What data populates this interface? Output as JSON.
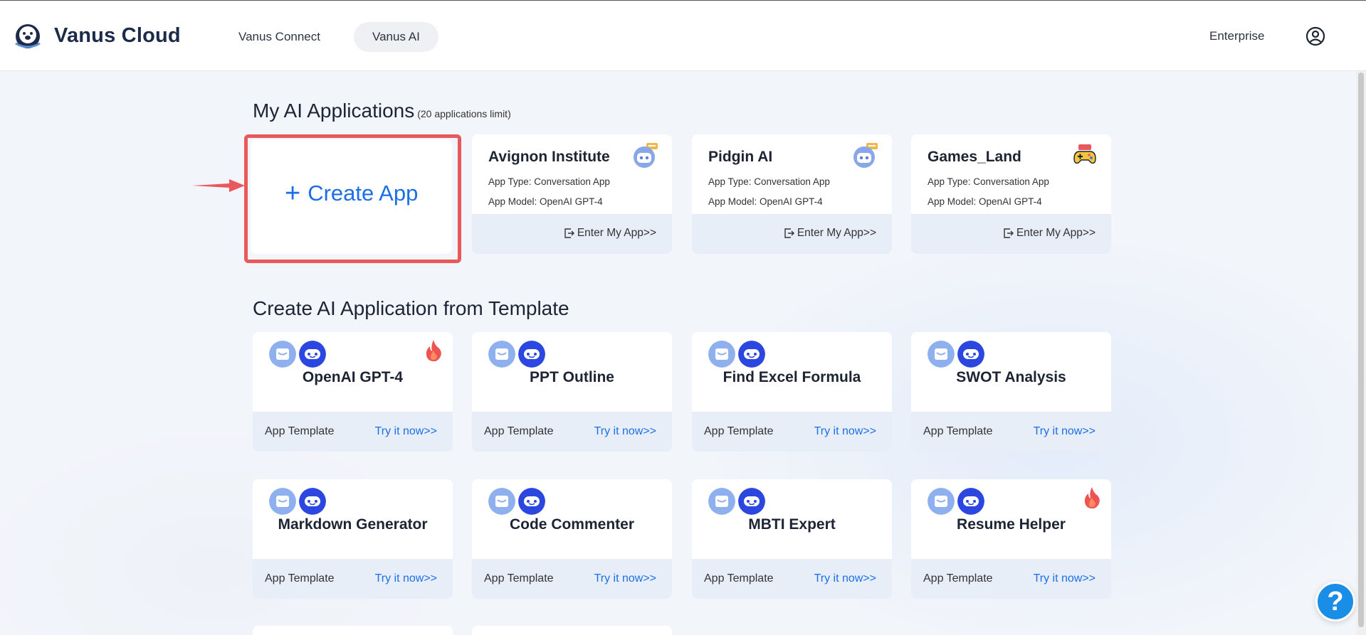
{
  "header": {
    "brand": "Vanus Cloud",
    "nav": [
      {
        "label": "Vanus Connect",
        "active": false
      },
      {
        "label": "Vanus AI",
        "active": true
      }
    ],
    "enterprise": "Enterprise"
  },
  "my_apps": {
    "title": "My AI Applications",
    "limit": "(20 applications limit)",
    "create_label": "Create App",
    "apps": [
      {
        "name": "Avignon Institute",
        "type": "App Type: Conversation App",
        "model": "App Model: OpenAI GPT-4",
        "enter": "Enter My App>>",
        "icon": "robot-chat-icon"
      },
      {
        "name": "Pidgin AI",
        "type": "App Type: Conversation App",
        "model": "App Model: OpenAI GPT-4",
        "enter": "Enter My App>>",
        "icon": "robot-chat-icon"
      },
      {
        "name": "Games_Land",
        "type": "App Type: Conversation App",
        "model": "App Model: OpenAI GPT-4",
        "enter": "Enter My App>>",
        "icon": "game-controller-icon"
      }
    ]
  },
  "templates": {
    "title": "Create AI Application from Template",
    "label": "App Template",
    "try": "Try it now>>",
    "items": [
      {
        "name": "OpenAI GPT-4",
        "hot": true
      },
      {
        "name": "PPT Outline",
        "hot": false
      },
      {
        "name": "Find Excel Formula",
        "hot": false
      },
      {
        "name": "SWOT Analysis",
        "hot": false
      },
      {
        "name": "Markdown Generator",
        "hot": false
      },
      {
        "name": "Code Commenter",
        "hot": false
      },
      {
        "name": "MBTI Expert",
        "hot": false
      },
      {
        "name": "Resume Helper",
        "hot": true
      }
    ]
  },
  "help": {
    "label": "?"
  },
  "colors": {
    "accent": "#1a6fe8",
    "highlight": "#e9585c",
    "footer_bg": "#e8eef8"
  }
}
